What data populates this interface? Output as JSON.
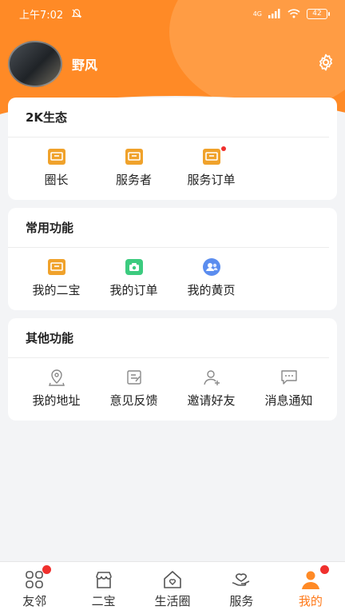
{
  "status_bar": {
    "time": "上午7:02",
    "signal": "4G",
    "battery": "42"
  },
  "profile": {
    "username": "野风"
  },
  "colors": {
    "brand": "#ff8a26",
    "accent_tab": "#ff7a1a",
    "badge": "#f0302d",
    "icon_orange": "#f0a22b",
    "icon_green": "#3ccb7f",
    "icon_blue": "#5b8def"
  },
  "ecology": {
    "title": "2K生态",
    "items": [
      {
        "label": "圈长",
        "icon": "orange-box-icon"
      },
      {
        "label": "服务者",
        "icon": "orange-box-icon"
      },
      {
        "label": "服务订单",
        "icon": "orange-box-icon"
      }
    ]
  },
  "common": {
    "title": "常用功能",
    "items": [
      {
        "label": "我的二宝",
        "icon": "orange-box-icon"
      },
      {
        "label": "我的订单",
        "icon": "green-camera-icon"
      },
      {
        "label": "我的黄页",
        "icon": "blue-contacts-icon"
      }
    ]
  },
  "other": {
    "title": "其他功能",
    "items": [
      {
        "label": "我的地址",
        "icon": "location-icon"
      },
      {
        "label": "意见反馈",
        "icon": "feedback-icon"
      },
      {
        "label": "邀请好友",
        "icon": "add-user-icon"
      },
      {
        "label": "消息通知",
        "icon": "message-icon"
      }
    ]
  },
  "tabbar": {
    "items": [
      {
        "label": "友邻",
        "icon": "grid-icon"
      },
      {
        "label": "二宝",
        "icon": "shop-icon"
      },
      {
        "label": "生活圈",
        "icon": "home-heart-icon"
      },
      {
        "label": "服务",
        "icon": "handshake-icon"
      },
      {
        "label": "我的",
        "icon": "user-icon"
      }
    ]
  }
}
